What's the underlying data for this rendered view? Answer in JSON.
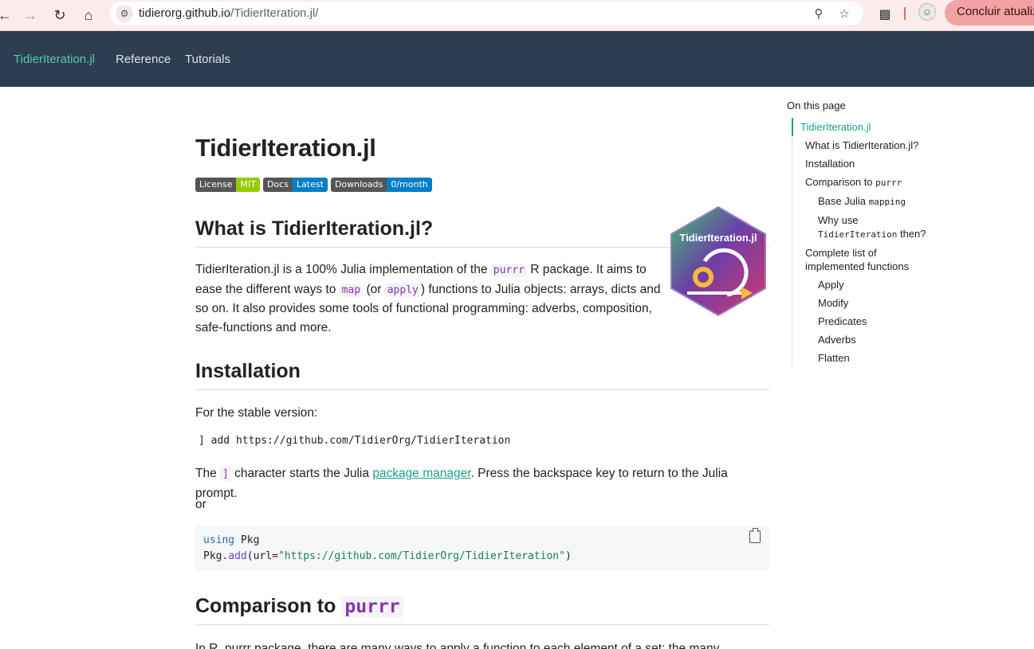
{
  "browser": {
    "url_host": "tidierorg.github.io",
    "url_path": "/TidierIteration.jl/",
    "update_button": "Concluir atualização"
  },
  "navbar": {
    "brand": "TidierIteration.jl",
    "links": [
      "Reference",
      "Tutorials"
    ]
  },
  "page": {
    "title": "TidierIteration.jl",
    "badges": [
      {
        "left": "License",
        "right": "MIT",
        "color": "#97ca00"
      },
      {
        "left": "Docs",
        "right": "Latest",
        "color": "#007ec6"
      },
      {
        "left": "Downloads",
        "right": "0/month",
        "color": "#007ec6"
      }
    ],
    "what_heading": "What is TidierIteration.jl?",
    "what_p": {
      "t1": "TidierIteration.jl is a 100% Julia implementation of the ",
      "c1": "purrr",
      "t2": " R package. It aims to ease the different ways to ",
      "c2": "map",
      "t3": " (or ",
      "c3": "apply",
      "t4": ") functions to Julia objects: arrays, dicts and so on. It also provides some tools of functional programming: adverbs, composition, safe-functions and more."
    },
    "logo_text": "TidierIteration.jl",
    "install_heading": "Installation",
    "stable_text": "For the stable version:",
    "pkg_command": "] add https://github.com/TidierOrg/TidierIteration",
    "bracket_p": {
      "t1": "The ",
      "c1": "]",
      "t2": " character starts the Julia ",
      "link": "package manager",
      "t3": ". Press the backspace key to return to the Julia prompt."
    },
    "or_text": "or",
    "code_block": {
      "line1_kw": "using",
      "line1_rest": " Pkg",
      "line2_a": "Pkg.",
      "line2_fn": "add",
      "line2_b": "(url=",
      "line2_str": "\"https://github.com/TidierOrg/TidierIteration\"",
      "line2_c": ")"
    },
    "compare_heading_text": "Comparison to ",
    "compare_heading_code": "purrr",
    "in_r_p": "In R, purrr package, there are many ways to apply a function to each element of a set; the many"
  },
  "toc": {
    "title": "On this page",
    "items": [
      {
        "label": "TidierIteration.jl",
        "level": 0,
        "active": true
      },
      {
        "label": "What is TidierIteration.jl?",
        "level": 1
      },
      {
        "label": "Installation",
        "level": 1
      },
      {
        "label": "Comparison to",
        "code": "purrr",
        "level": 1
      },
      {
        "label": "Base Julia",
        "code": "mapping",
        "level": 2
      },
      {
        "label": "Why use",
        "code": "TidierIteration",
        "suffix": "then?",
        "level": 2
      },
      {
        "label": "Complete list of implemented functions",
        "level": 1
      },
      {
        "label": "Apply",
        "level": 2
      },
      {
        "label": "Modify",
        "level": 2
      },
      {
        "label": "Predicates",
        "level": 2
      },
      {
        "label": "Adverbs",
        "level": 2
      },
      {
        "label": "Flatten",
        "level": 2
      }
    ]
  }
}
